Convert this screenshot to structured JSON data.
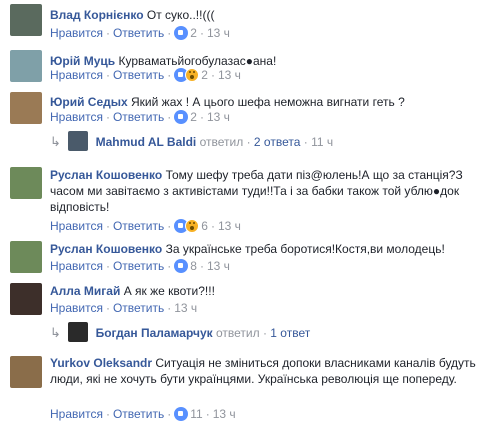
{
  "comments": [
    {
      "author": "Влад Корнієнко",
      "text": "От суко..!!(((",
      "reply": "Ответить",
      "like": "Нравится",
      "count": "2",
      "time": "13 ч",
      "avatar": "#5a6a5e"
    },
    {
      "author": "Юрій Муць",
      "text": "Курвaматьйогобулазас●ана!",
      "reply": "Ответить",
      "like": "Нравится",
      "count": "2",
      "time": "13 ч",
      "avatar": "#7fa0a8"
    },
    {
      "author": "Юрий Седых",
      "text": "Який жах ! А цього шефа неможна вигнати геть ?",
      "reply": "Ответить",
      "like": "Нравится",
      "count": "2",
      "time": "13 ч",
      "avatar": "#9a7a55"
    },
    {
      "author": "Руслан Кошовенко",
      "text": "Тому шефу треба дати піз@юлень!А що за станція?З часом ми завітаємо з активістами туди!!Та і за бабки також той ублю●док відповість!",
      "reply": "Ответить",
      "like": "Нравится",
      "count": "6",
      "time": "13 ч",
      "avatar": "#6d8a5a"
    },
    {
      "author": "Руслан Кошовенко",
      "text": "За українське треба боротися!Костя,ви молодець!",
      "reply": "Ответить",
      "like": "Нравится",
      "count": "8",
      "time": "13 ч",
      "avatar": "#6d8a5a"
    },
    {
      "author": "Алла Мигай",
      "text": "А як же квоти?!!!",
      "reply": "Ответить",
      "like": "Нравится",
      "count": "",
      "time": "13 ч",
      "avatar": "#3d2f2a"
    },
    {
      "author": "Yurkov Oleksandr",
      "text": "Ситуація не зміниться допоки власниками каналів будуть люди, які не хочуть бути українцями. Українська революція ще попереду.",
      "reply": "Ответить",
      "like": "Нравится",
      "count": "11",
      "time": "13 ч",
      "avatar": "#8a6d4a"
    }
  ],
  "replies": [
    {
      "name": "Mahmud AL Baldi",
      "verb": "ответил",
      "count": "2 ответа",
      "time": "11 ч"
    },
    {
      "name": "Богдан Паламарчук",
      "verb": "ответил",
      "count": "1 ответ",
      "time": ""
    }
  ]
}
